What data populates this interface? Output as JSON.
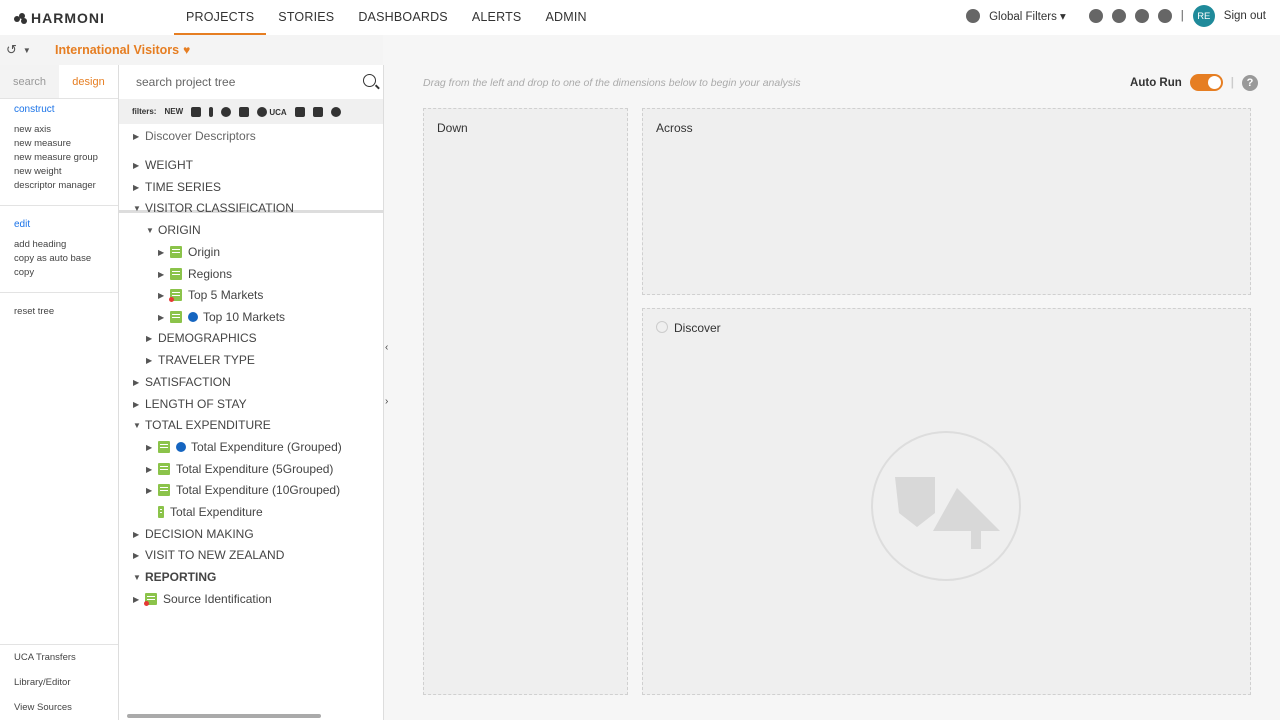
{
  "app": {
    "logo": "HARMONI"
  },
  "nav": {
    "items": [
      "PROJECTS",
      "STORIES",
      "DASHBOARDS",
      "ALERTS",
      "ADMIN"
    ],
    "active": "PROJECTS"
  },
  "topright": {
    "global_filters": "Global Filters",
    "avatar": "RE",
    "signout": "Sign out"
  },
  "project": {
    "title": "International Visitors"
  },
  "left": {
    "tabs": [
      "search",
      "design"
    ],
    "construct": {
      "heading": "construct",
      "items": [
        "new axis",
        "new measure",
        "new measure group",
        "new weight",
        "descriptor manager"
      ]
    },
    "edit": {
      "heading": "edit",
      "items": [
        "add heading",
        "copy as auto base",
        "copy"
      ]
    },
    "reset": "reset tree",
    "bottom": [
      "UCA Transfers",
      "Library/Editor",
      "View Sources"
    ]
  },
  "tree": {
    "search_placeholder": "search project tree",
    "filters_label": "filters:",
    "filters_new": "NEW",
    "filters_uca": "UCA",
    "items": {
      "discover": "Discover Descriptors",
      "weight": "WEIGHT",
      "timeseries": "TIME SERIES",
      "visitorclass": "VISITOR CLASSIFICATION",
      "origin_group": "ORIGIN",
      "origin": "Origin",
      "regions": "Regions",
      "top5": "Top 5 Markets",
      "top10": "Top 10 Markets",
      "demographics": "DEMOGRAPHICS",
      "travelertype": "TRAVELER TYPE",
      "satisfaction": "SATISFACTION",
      "lengthstay": "LENGTH OF STAY",
      "totalexp": "TOTAL EXPENDITURE",
      "te_grouped": "Total Expenditure (Grouped)",
      "te_5": "Total Expenditure (5Grouped)",
      "te_10": "Total Expenditure (10Grouped)",
      "te": "Total Expenditure",
      "decision": "DECISION MAKING",
      "visitnz": "VISIT TO NEW ZEALAND",
      "reporting": "REPORTING",
      "sourceid": "Source Identification"
    }
  },
  "main": {
    "hint": "Drag from the left and drop to one of the dimensions below to begin your analysis",
    "autorun": "Auto Run",
    "zones": {
      "down": "Down",
      "across": "Across",
      "discover": "Discover"
    }
  },
  "colors": {
    "accent": "#e67e22",
    "link": "#1a73e8",
    "green": "#8bc34a",
    "avatar": "#1f8a9a"
  }
}
